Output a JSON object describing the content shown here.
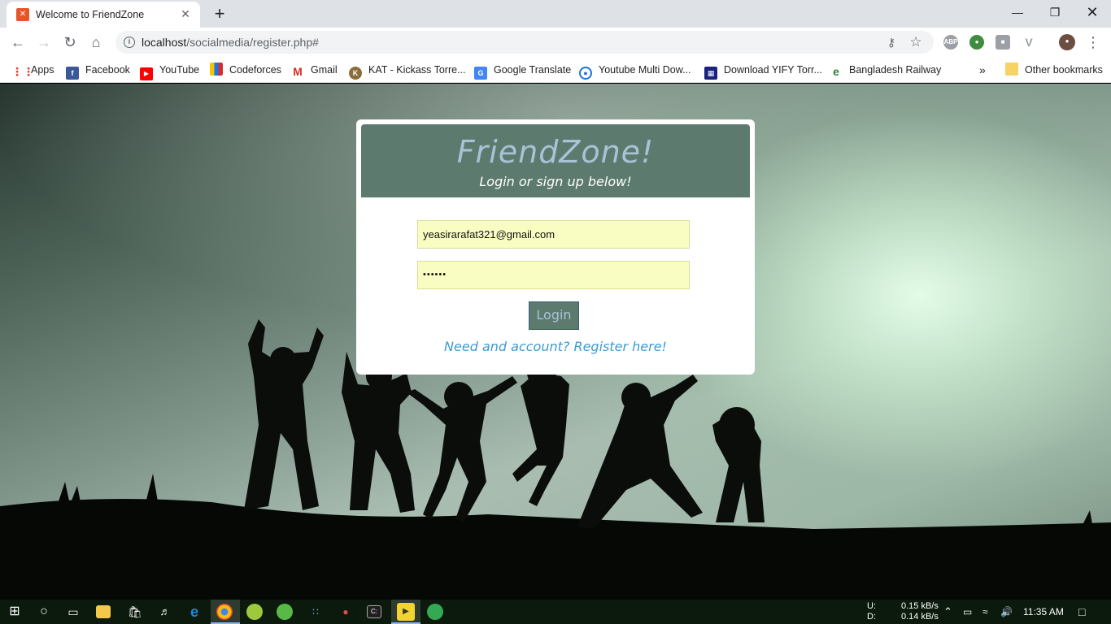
{
  "browser": {
    "tab_title": "Welcome to FriendZone",
    "tab_favicon": "xampp-icon",
    "url_host": "localhost",
    "url_path": "/socialmedia/register.php#",
    "window_controls": [
      "minimize-icon",
      "restore-icon",
      "close-icon"
    ]
  },
  "bookmarks": [
    {
      "label": "Apps",
      "icon": "apps-grid-icon",
      "color": "#ea4335"
    },
    {
      "label": "Facebook",
      "icon": "facebook-icon",
      "color": "#3b5998"
    },
    {
      "label": "YouTube",
      "icon": "youtube-icon",
      "color": "#ff0000"
    },
    {
      "label": "Codeforces",
      "icon": "codeforces-icon",
      "color": "#f5c400"
    },
    {
      "label": "Gmail",
      "icon": "gmail-icon",
      "color": "#d93025"
    },
    {
      "label": "KAT - Kickass Torre...",
      "icon": "kat-icon",
      "color": "#8a6d3b"
    },
    {
      "label": "Google Translate",
      "icon": "translate-icon",
      "color": "#4285f4"
    },
    {
      "label": "Youtube Multi Dow...",
      "icon": "download-icon",
      "color": "#1a73e8"
    },
    {
      "label": "Download YIFY Torr...",
      "icon": "film-icon",
      "color": "#1a237e"
    },
    {
      "label": "Bangladesh Railway",
      "icon": "railway-icon",
      "color": "#2e7d32"
    }
  ],
  "bookmarks_overflow": "»",
  "other_bookmarks": "Other bookmarks",
  "page": {
    "brand": "FriendZone!",
    "subtitle": "Login or sign up below!",
    "email_value": "yeasirarafat321@gmail.com",
    "password_value": "••••••",
    "login_label": "Login",
    "register_link": "Need and account? Register here!"
  },
  "taskbar": {
    "upload_label": "U:",
    "download_label": "D:",
    "upload_speed": "0.15 kB/s",
    "download_speed": "0.14 kB/s",
    "clock": "11:35 AM"
  },
  "colors": {
    "card_header": "#5c7a6e",
    "brand_text": "#a9c2d6",
    "input_bg": "#fafdc1",
    "link": "#3d9bd0"
  }
}
